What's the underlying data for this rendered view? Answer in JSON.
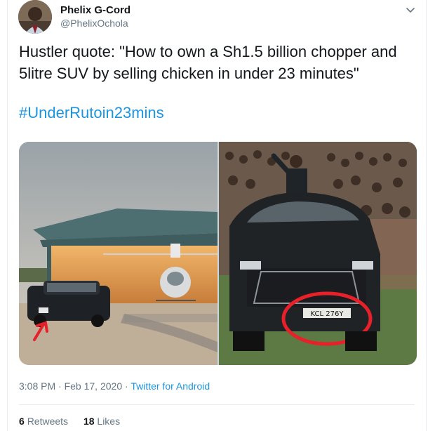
{
  "author": {
    "name": "Phelix G-Cord",
    "handle": "@PhelixOchola"
  },
  "tweet": {
    "text": "Hustler quote: \"How to own a Sh1.5 billion chopper and 5litre SUV by selling chicken in under 23 minutes\"",
    "hashtag": "#UnderRutoin23mins"
  },
  "media": {
    "left_photo": "hangar-helicopter-suv-photo",
    "right_photo": "suv-crowd-photo",
    "plate_text": "KCL 276Y"
  },
  "meta": {
    "time": "3:08 PM",
    "separator": " · ",
    "date": "Feb 17, 2020",
    "source": "Twitter for Android"
  },
  "stats": {
    "retweets_count": "6",
    "retweets_label": "Retweets",
    "likes_count": "18",
    "likes_label": "Likes"
  },
  "colors": {
    "link": "#1b95e0",
    "secondary": "#657786",
    "primary": "#14171a",
    "border": "#e6ecf0"
  },
  "icons": {
    "caret": "chevron-down-icon"
  }
}
